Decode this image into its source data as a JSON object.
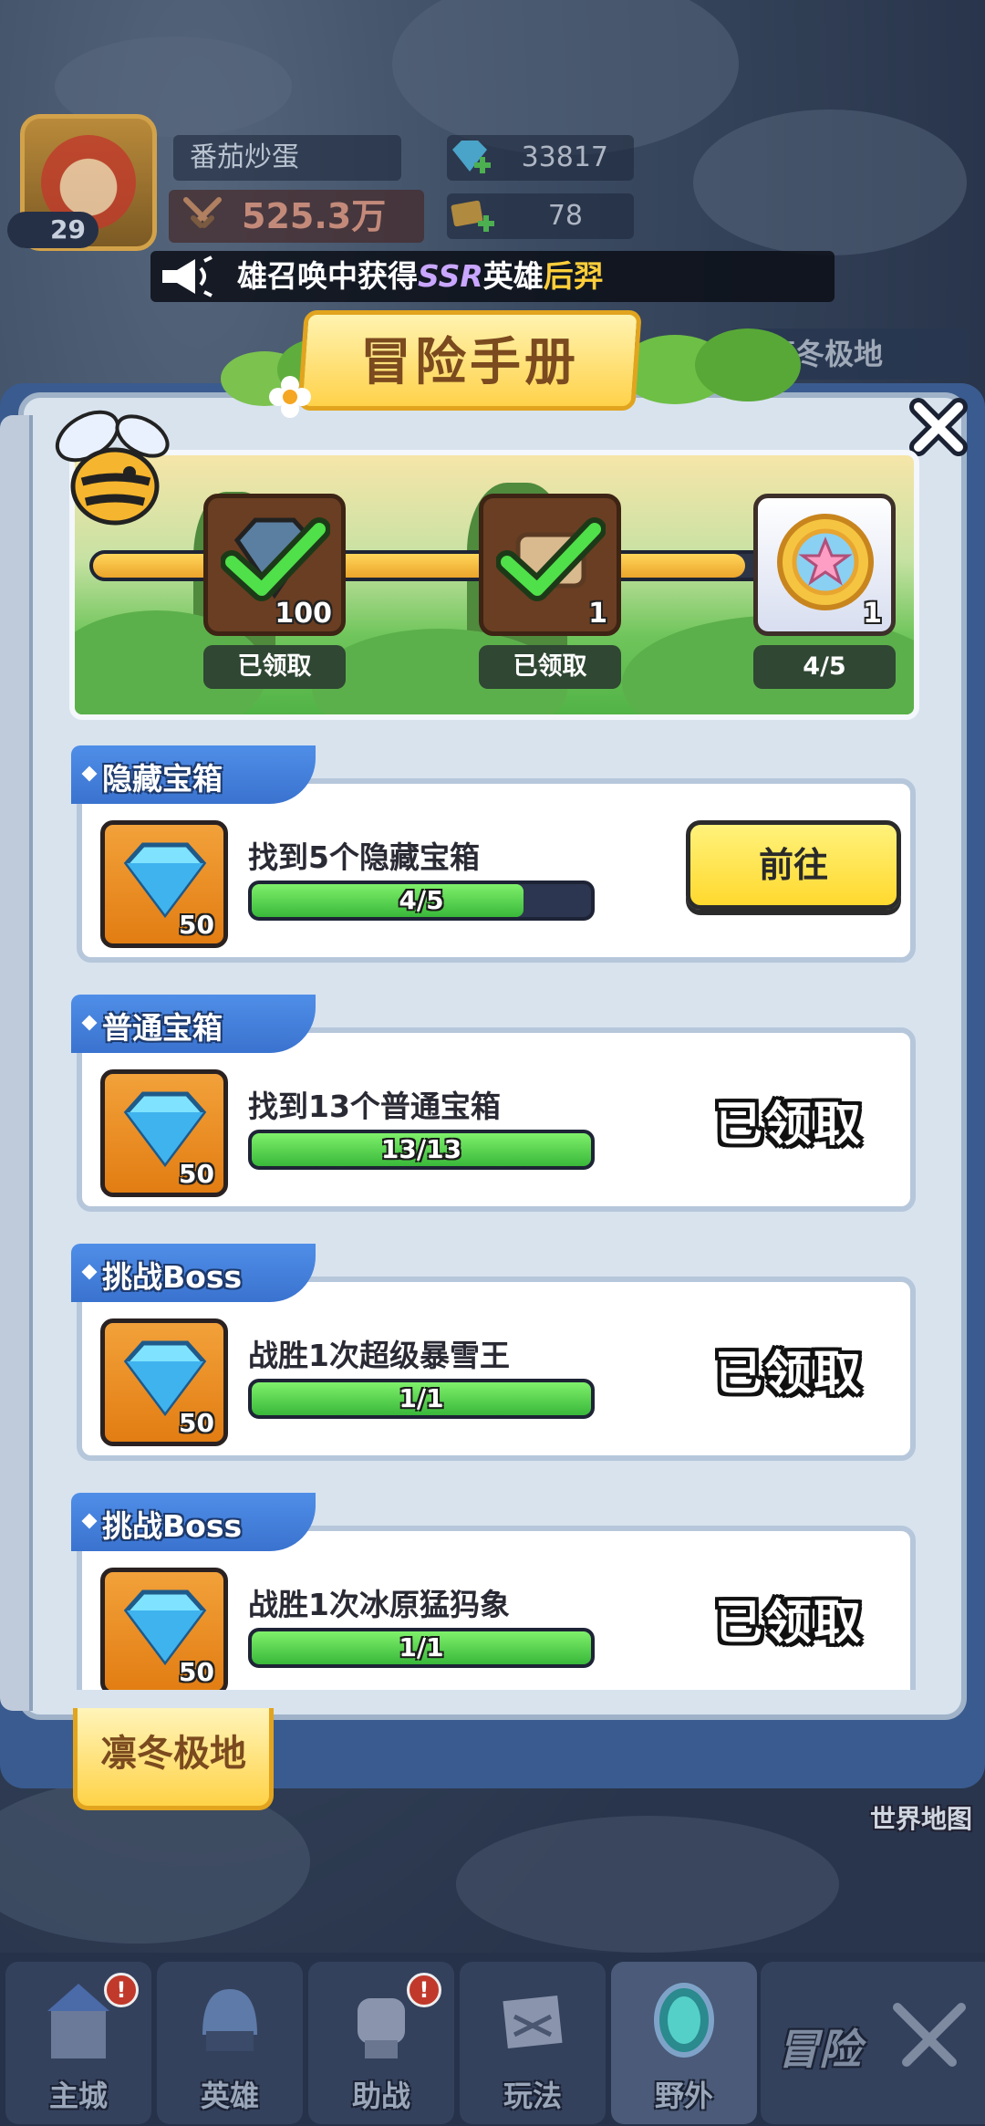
{
  "hud": {
    "player_name": "番茄炒蛋",
    "power": "525.3万",
    "gems": "33817",
    "tickets": "78",
    "level": "29"
  },
  "announcement": {
    "prefix": "雄召唤中获得",
    "rarity": "SSR",
    "middle": "英雄",
    "hero": "后羿"
  },
  "region_top_right": "凛冬极地",
  "panel": {
    "title": "冒险手册",
    "milestones": [
      {
        "icon": "gem-icon",
        "count": "100",
        "status": "已领取",
        "state": "claimed"
      },
      {
        "icon": "scroll-icon",
        "count": "1",
        "status": "已领取",
        "state": "claimed"
      },
      {
        "icon": "star-coin-icon",
        "count": "1",
        "status": "4/5",
        "state": "in-progress"
      }
    ],
    "track_progress": 0.82
  },
  "tasks": [
    {
      "tag": "隐藏宝箱",
      "reward_count": "50",
      "desc": "找到5个隐藏宝箱",
      "progress_text": "4/5",
      "progress": 0.8,
      "action": "前往",
      "claimed": false
    },
    {
      "tag": "普通宝箱",
      "reward_count": "50",
      "desc": "找到13个普通宝箱",
      "progress_text": "13/13",
      "progress": 1.0,
      "action": "已领取",
      "claimed": true
    },
    {
      "tag": "挑战Boss",
      "reward_count": "50",
      "desc": "战胜1次超级暴雪王",
      "progress_text": "1/1",
      "progress": 1.0,
      "action": "已领取",
      "claimed": true
    },
    {
      "tag": "挑战Boss",
      "reward_count": "50",
      "desc": "战胜1次冰原猛犸象",
      "progress_text": "1/1",
      "progress": 1.0,
      "action": "已领取",
      "claimed": true
    }
  ],
  "region_tab": "凛冬极地",
  "world_map": "世界地图",
  "nav": {
    "main_city": "主城",
    "heroes": "英雄",
    "assist": "助战",
    "play": "玩法",
    "field": "野外",
    "adventure": "冒险"
  },
  "colors": {
    "accent_yellow": "#ffd92e",
    "tag_blue": "#3a73cf",
    "progress_green": "#39b83a"
  }
}
